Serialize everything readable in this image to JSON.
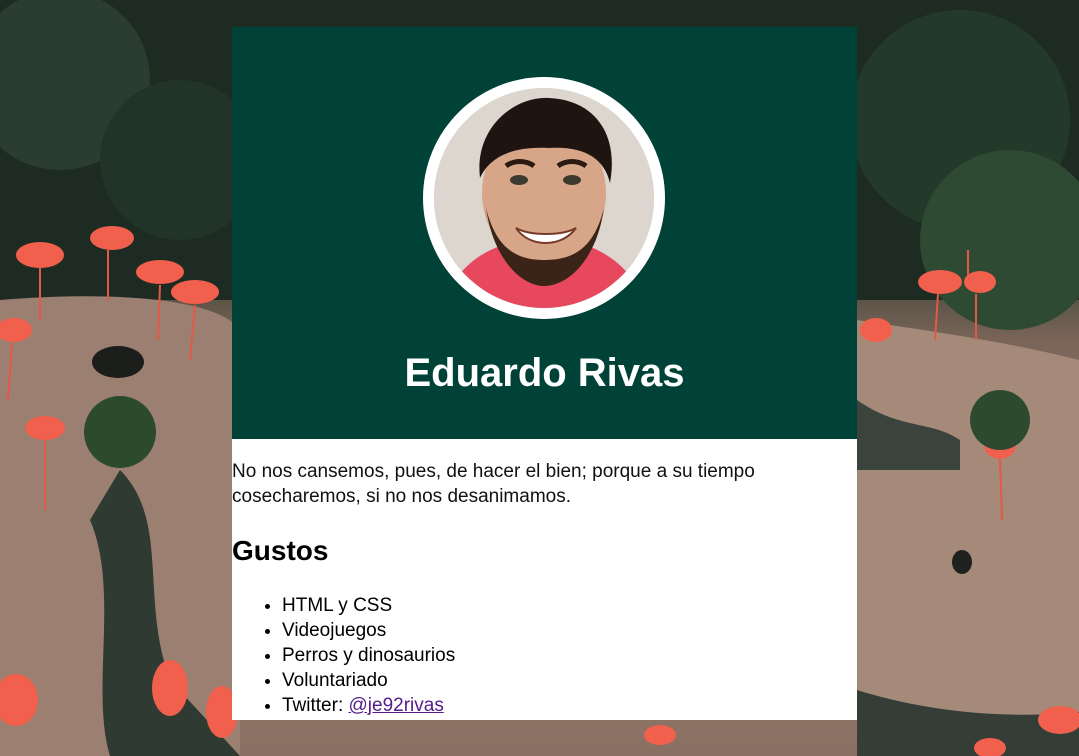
{
  "profile": {
    "name": "Eduardo Rivas",
    "quote": "No nos cansemos, pues, de hacer el bien; porque a su tiempo cosecharemos, si no nos desanimamos."
  },
  "likes": {
    "title": "Gustos",
    "items": [
      {
        "label": "HTML y CSS"
      },
      {
        "label": "Videojuegos"
      },
      {
        "label": "Perros y dinosaurios"
      },
      {
        "label": "Voluntariado"
      }
    ],
    "twitter": {
      "prefix": "Twitter: ",
      "handle": "@je92rivas"
    }
  },
  "colors": {
    "header_bg": "#004237",
    "card_bg": "#ffffff",
    "link": "#551a8b"
  }
}
